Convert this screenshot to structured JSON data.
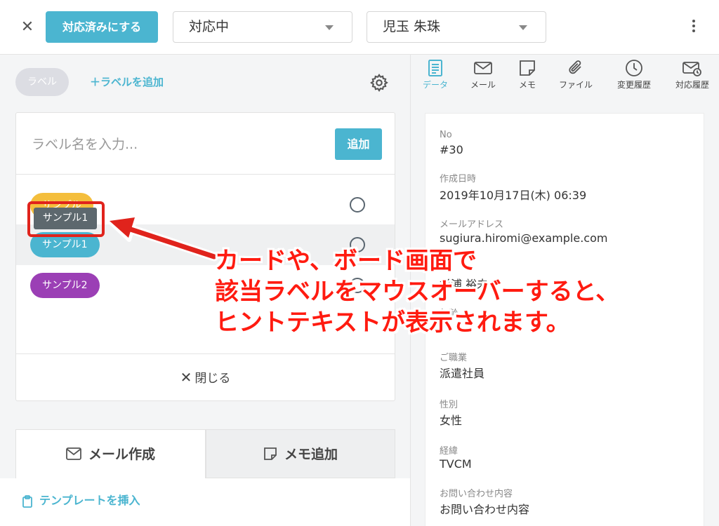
{
  "header": {
    "done_button": "対応済みにする",
    "status_select": "対応中",
    "assignee_select": "児玉 朱珠"
  },
  "labels": {
    "chip": "ラベル",
    "add_link": "＋ラベルを追加",
    "input_placeholder": "ラベル名を入力...",
    "add_button": "追加",
    "items": [
      {
        "name": "サンプル",
        "color": "#f4be3c"
      },
      {
        "name": "サンプル1",
        "color": "#4bb5d0"
      },
      {
        "name": "サンプル2",
        "color": "#9b3fb5"
      }
    ],
    "tooltip": "サンプル1",
    "close": "閉じる"
  },
  "compose": {
    "tab_mail": "メール作成",
    "tab_memo": "メモ追加",
    "template": "テンプレートを挿入"
  },
  "side_tabs": [
    {
      "label": "データ",
      "icon": "document-icon",
      "active": true
    },
    {
      "label": "メール",
      "icon": "envelope-icon"
    },
    {
      "label": "メモ",
      "icon": "memo-icon"
    },
    {
      "label": "ファイル",
      "icon": "paperclip-icon"
    },
    {
      "label": "変更履歴",
      "icon": "clock-icon"
    },
    {
      "label": "対応履歴",
      "icon": "mail-clock-icon"
    }
  ],
  "record": {
    "no_label": "No",
    "no": "#30",
    "created_label": "作成日時",
    "created": "2019年10月17日(木) 06:39",
    "email_label": "メールアドレス",
    "email": "sugiura.hiromi@example.com",
    "name_label": "お",
    "name": "杉浦 裕未",
    "age_label": "年齢",
    "job_label": "ご職業",
    "job": "派遣社員",
    "gender_label": "性別",
    "gender": "女性",
    "source_label": "経緯",
    "source": "TVCM",
    "inquiry_label": "お問い合わせ内容",
    "inquiry": "お問い合わせ内容"
  },
  "annotation": {
    "line1": "カードや、ボード画面で",
    "line2": "該当ラベルをマウスオーバーすると、",
    "line3": "ヒントテキストが表示されます。"
  },
  "colors": {
    "accent": "#4bb5d0",
    "annotation": "#e0231c"
  }
}
